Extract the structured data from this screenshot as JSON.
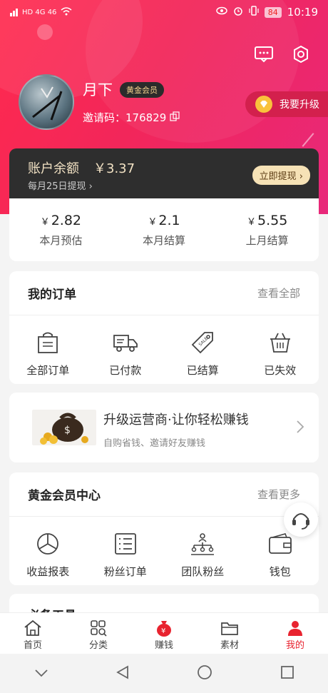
{
  "status_bar": {
    "left": "HD 4G 46",
    "battery": "84",
    "time": "10:19"
  },
  "profile": {
    "name": "月下",
    "level": "黄金会员",
    "invite_label": "邀请码：176829",
    "upgrade": "我要升级"
  },
  "balance": {
    "label": "账户余额",
    "amount": "￥3.37",
    "note": "每月25日提现 ›",
    "withdraw": "立即提现 ›"
  },
  "stats": [
    {
      "currency": "￥",
      "value": "2.82",
      "label": "本月预估"
    },
    {
      "currency": "￥",
      "value": "2.1",
      "label": "本月结算"
    },
    {
      "currency": "￥",
      "value": "5.55",
      "label": "上月结算"
    }
  ],
  "orders": {
    "title": "我的订单",
    "more": "查看全部",
    "items": [
      {
        "label": "全部订单",
        "icon": "bag-icon"
      },
      {
        "label": "已付款",
        "icon": "truck-icon"
      },
      {
        "label": "已结算",
        "icon": "tag-icon"
      },
      {
        "label": "已失效",
        "icon": "basket-icon"
      }
    ]
  },
  "promo": {
    "title": "升级运营商·让你轻松赚钱",
    "subtitle": "自购省钱、邀请好友赚钱"
  },
  "gold_center": {
    "title": "黄金会员中心",
    "more": "查看更多",
    "items": [
      {
        "label": "收益报表",
        "icon": "pie-chart-icon"
      },
      {
        "label": "粉丝订单",
        "icon": "list-icon"
      },
      {
        "label": "团队粉丝",
        "icon": "team-icon"
      },
      {
        "label": "钱包",
        "icon": "wallet-icon"
      }
    ]
  },
  "tools_peek": "必备工具",
  "tabbar": [
    {
      "label": "首页",
      "icon": "home-icon"
    },
    {
      "label": "分类",
      "icon": "category-icon"
    },
    {
      "label": "赚钱",
      "icon": "money-bag-icon"
    },
    {
      "label": "素材",
      "icon": "folder-icon"
    },
    {
      "label": "我的",
      "icon": "user-icon",
      "active": true
    }
  ],
  "colors": {
    "brand": "#f2265a",
    "active": "#e8232f",
    "gold": "#f6e2b6"
  }
}
